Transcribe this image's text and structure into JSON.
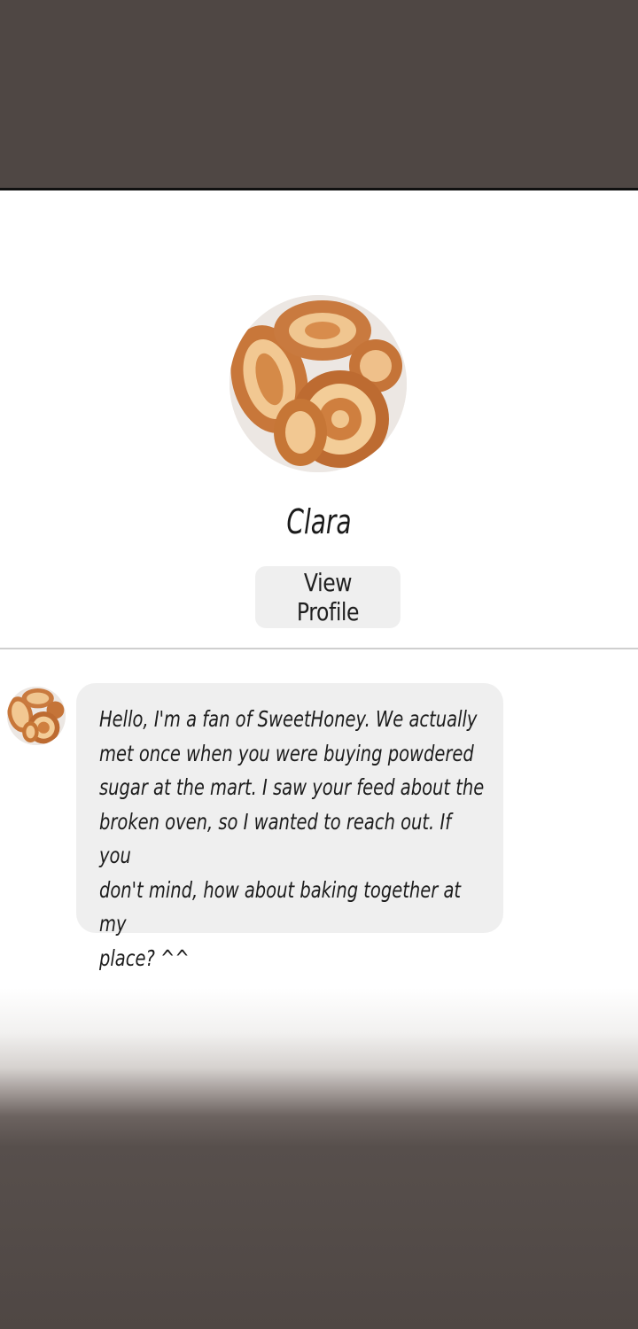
{
  "contact": {
    "name": "Clara",
    "view_profile_label": "View Profile",
    "avatar_icon": "pastry-avatar-icon"
  },
  "messages": [
    {
      "sender": "Clara",
      "text": "Hello, I'm a fan of SweetHoney. We actually\nmet once when you were buying powdered\nsugar at the mart. I saw your feed about the\nbroken oven, so I wanted to reach out. If you\ndon't mind, how about baking together at my\nplace? ^^"
    }
  ],
  "colors": {
    "frame_dark": "#4f4744",
    "bubble_bg": "#efefef",
    "button_bg": "#efefef"
  }
}
